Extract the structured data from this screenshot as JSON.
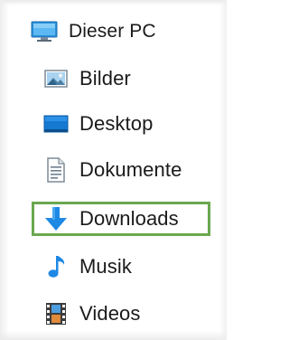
{
  "tree": {
    "root": {
      "label": "Dieser PC",
      "icon": "computer-icon"
    },
    "items": [
      {
        "label": "Bilder",
        "icon": "pictures-icon"
      },
      {
        "label": "Desktop",
        "icon": "desktop-icon"
      },
      {
        "label": "Dokumente",
        "icon": "document-icon"
      },
      {
        "label": "Downloads",
        "icon": "download-arrow-icon",
        "highlighted": true
      },
      {
        "label": "Musik",
        "icon": "music-note-icon"
      },
      {
        "label": "Videos",
        "icon": "video-film-icon"
      }
    ]
  },
  "colors": {
    "highlight_border": "#6aa84f",
    "icon_blue": "#1e88e5"
  }
}
